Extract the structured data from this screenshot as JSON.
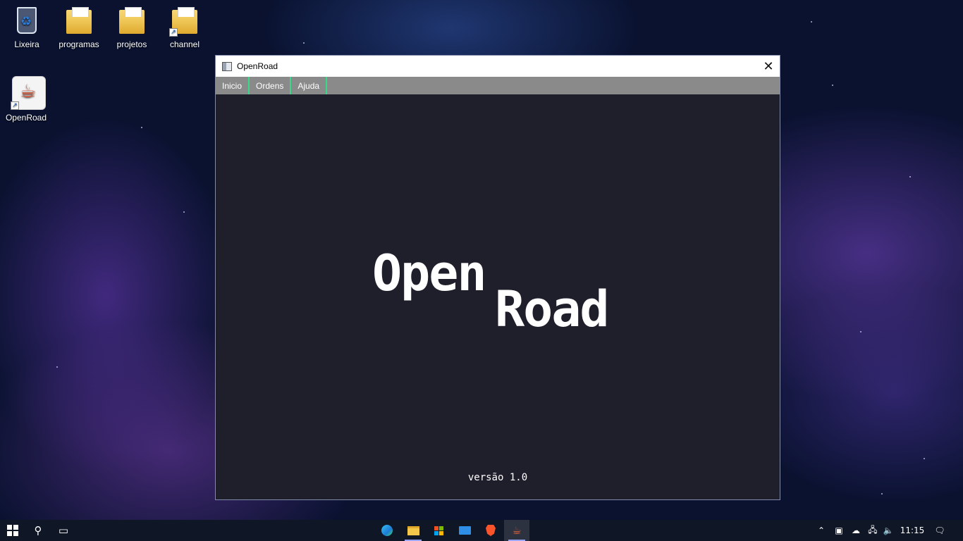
{
  "desktop": {
    "icons": [
      {
        "label": "Lixeira",
        "icon": "recycle-bin-icon"
      },
      {
        "label": "programas",
        "icon": "folder-icon"
      },
      {
        "label": "projetos",
        "icon": "folder-icon"
      },
      {
        "label": "channel",
        "icon": "folder-shortcut-icon"
      },
      {
        "label": "OpenRoad",
        "icon": "java-app-shortcut-icon"
      }
    ]
  },
  "window": {
    "title": "OpenRoad",
    "close_glyph": "✕",
    "menu": [
      "Inicio",
      "Ordens",
      "Ajuda"
    ],
    "menu_accent": "#39d98a",
    "logo": {
      "line1": "Open",
      "line2": "Road"
    },
    "version": "versão 1.0",
    "background": "#1f1e2b"
  },
  "taskbar": {
    "start_icon": "windows-start-icon",
    "search_icon": "search-icon",
    "task_view_icon": "task-view-icon",
    "apps": [
      {
        "icon": "edge-icon"
      },
      {
        "icon": "file-explorer-icon"
      },
      {
        "icon": "microsoft-store-icon"
      },
      {
        "icon": "mail-icon"
      },
      {
        "icon": "brave-icon"
      },
      {
        "icon": "java-icon"
      }
    ],
    "clock": "11:15"
  }
}
